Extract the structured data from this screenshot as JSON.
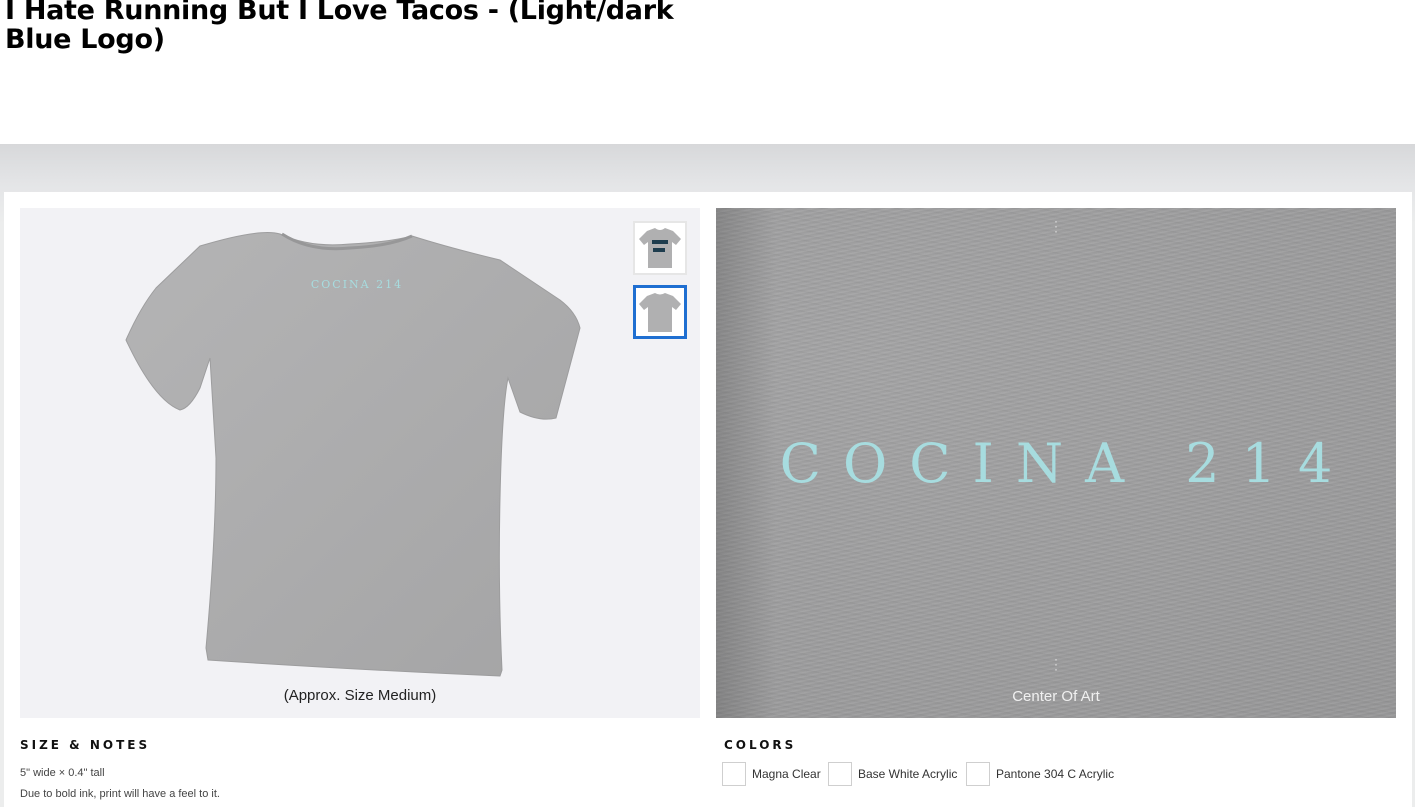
{
  "product": {
    "title": "I Hate Running But I Love Tacos - (Light/dark Blue Logo)"
  },
  "preview": {
    "caption": "(Approx. Size Medium)",
    "shirt_print": "COCINA 214",
    "thumbnails": [
      {
        "label": "front view",
        "active": false
      },
      {
        "label": "back view",
        "active": true
      }
    ]
  },
  "zoom": {
    "print_text": "COCINA 214",
    "caption": "Center Of Art"
  },
  "size_notes": {
    "heading": "SIZE & NOTES",
    "dimensions": "5\" wide × 0.4\" tall",
    "note": "Due to bold ink, print will have a feel to it."
  },
  "colors": {
    "heading": "COLORS",
    "options": [
      {
        "label": "Magna Clear"
      },
      {
        "label": "Base White Acrylic"
      },
      {
        "label": "Pantone 304 C Acrylic"
      }
    ]
  },
  "palette": {
    "shirt_grey": "#a9a9aa",
    "print_blue": "#a7dcdf",
    "active_thumb_border": "#1f6fd1"
  }
}
